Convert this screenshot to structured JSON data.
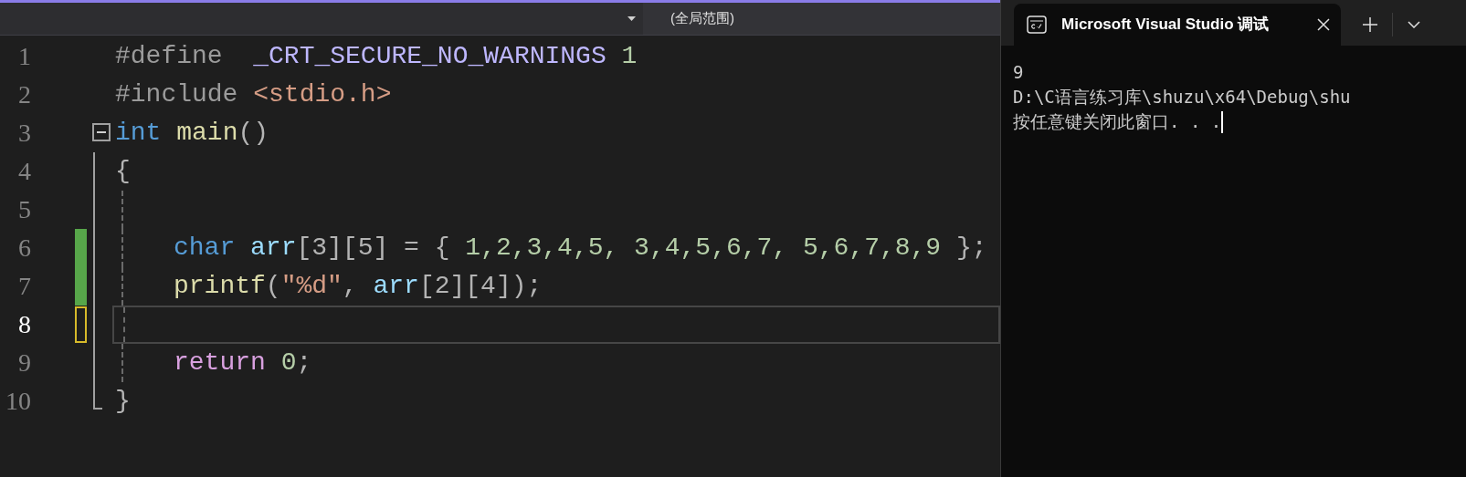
{
  "editor": {
    "scope_dropdown": "(全局范围)",
    "lines": [
      {
        "number": "1",
        "indented": false,
        "current": false,
        "foldable": false,
        "modified": false,
        "tokens": [
          {
            "text": "#define  ",
            "kind": "preprocessor"
          },
          {
            "text": "_CRT_SECURE_NO_WARNINGS",
            "kind": "macro"
          },
          {
            "text": " 1",
            "kind": "number"
          }
        ]
      },
      {
        "number": "2",
        "indented": false,
        "current": false,
        "foldable": false,
        "modified": false,
        "tokens": [
          {
            "text": "#include ",
            "kind": "preprocessor"
          },
          {
            "text": "<stdio.h>",
            "kind": "string"
          }
        ]
      },
      {
        "number": "3",
        "indented": false,
        "current": false,
        "foldable": true,
        "modified": false,
        "tokens": [
          {
            "text": "int",
            "kind": "keyword"
          },
          {
            "text": " main",
            "kind": "function"
          },
          {
            "text": "()",
            "kind": "punct"
          }
        ]
      },
      {
        "number": "4",
        "indented": false,
        "current": false,
        "foldable": false,
        "modified": false,
        "tokens": [
          {
            "text": "{",
            "kind": "punct"
          }
        ]
      },
      {
        "number": "5",
        "indented": true,
        "current": false,
        "foldable": false,
        "modified": false
      },
      {
        "number": "6",
        "indented": true,
        "current": false,
        "foldable": false,
        "modified": true,
        "saved": true,
        "tokens": [
          {
            "text": "char",
            "kind": "keyword"
          },
          {
            "text": " arr",
            "kind": "variable"
          },
          {
            "text": "[3][5] = { ",
            "kind": "punct"
          },
          {
            "text": "1,2,3,4,5, 3,4,5,6,7, 5,6,7,8,9",
            "kind": "number"
          },
          {
            "text": " };",
            "kind": "punct"
          }
        ]
      },
      {
        "number": "7",
        "indented": true,
        "current": false,
        "foldable": false,
        "modified": true,
        "saved": true,
        "tokens": [
          {
            "text": "printf",
            "kind": "function"
          },
          {
            "text": "(",
            "kind": "punct"
          },
          {
            "text": "\"%d\"",
            "kind": "string"
          },
          {
            "text": ", ",
            "kind": "punct"
          },
          {
            "text": "arr",
            "kind": "variable"
          },
          {
            "text": "[2][4]);",
            "kind": "punct"
          }
        ]
      },
      {
        "number": "8",
        "indented": true,
        "current": true,
        "foldable": false,
        "modified": true,
        "saved": false
      },
      {
        "number": "9",
        "indented": true,
        "current": false,
        "foldable": false,
        "modified": false,
        "tokens": [
          {
            "text": "return",
            "kind": "control"
          },
          {
            "text": " 0",
            "kind": "number"
          },
          {
            "text": ";",
            "kind": "punct"
          }
        ]
      },
      {
        "number": "10",
        "indented": false,
        "current": false,
        "foldable": false,
        "modified": false,
        "tokens": [
          {
            "text": "}",
            "kind": "punct"
          }
        ]
      }
    ]
  },
  "terminal": {
    "tab_title": "Microsoft Visual Studio 调试",
    "output": [
      "9",
      "D:\\C语言练习库\\shuzu\\x64\\Debug\\shu",
      "按任意键关闭此窗口. . ."
    ]
  }
}
